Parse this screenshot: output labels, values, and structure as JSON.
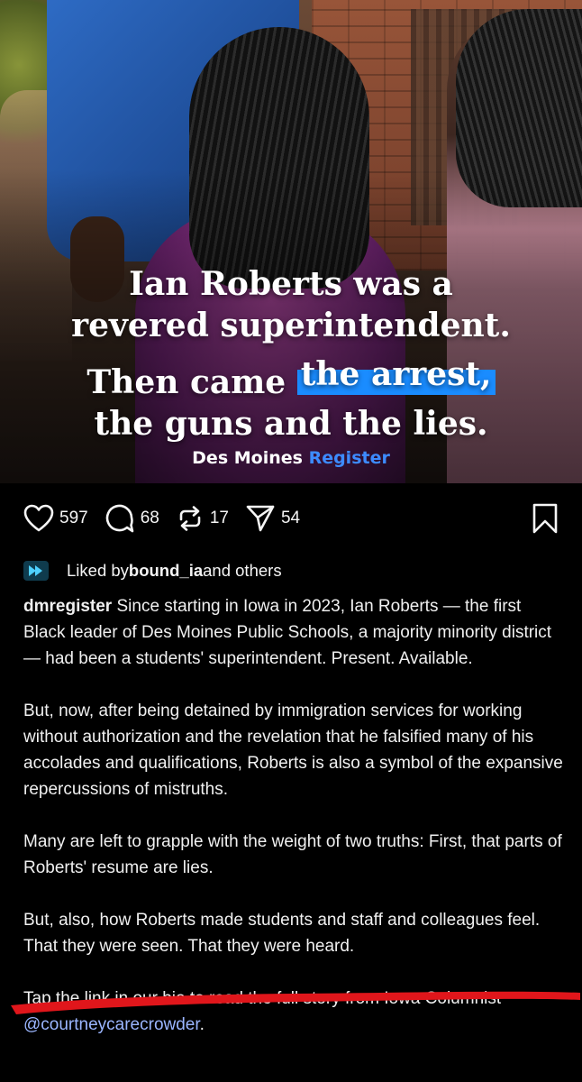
{
  "post": {
    "headline_line1": "Ian Roberts was a",
    "headline_line2": "revered superintendent.",
    "headline_line3_prefix": "Then came ",
    "headline_line3_highlight": "the arrest,",
    "headline_line4": "the guns and the lies.",
    "masthead_primary": "Des Moines",
    "masthead_accent": "Register",
    "highlight_color": "#1a8cff",
    "masthead_accent_color": "#3d8bff"
  },
  "actions": {
    "likes_count": "597",
    "comments_count": "68",
    "reposts_count": "17",
    "shares_count": "54"
  },
  "liked_by": {
    "prefix": "Liked by ",
    "user": "bound_ia",
    "suffix": " and others"
  },
  "caption": {
    "username": "dmregister",
    "paragraph1": " Since starting in Iowa in 2023, Ian Roberts — the first Black leader of Des Moines Public Schools, a majority minority district — had been a students' superintendent. Present. Available.",
    "paragraph2": "But, now, after being detained by immigration services for working without authorization and the revelation that he falsified many of his accolades and qualifications, Roberts is also a symbol of the expansive repercussions of mistruths.",
    "paragraph3": "Many are left to grapple with the weight of two truths: First, that parts of Roberts' resume are lies.",
    "paragraph4": "But, also, how Roberts made students and staff and colleagues feel. That they were seen. That they were heard.",
    "paragraph5_prefix": "Tap the link in our bio to read the full story from Iowa Columnist ",
    "mention": "@courtneycarecrowder",
    "paragraph5_suffix": "."
  },
  "annotation": {
    "red_underline_color": "#e0161b"
  }
}
